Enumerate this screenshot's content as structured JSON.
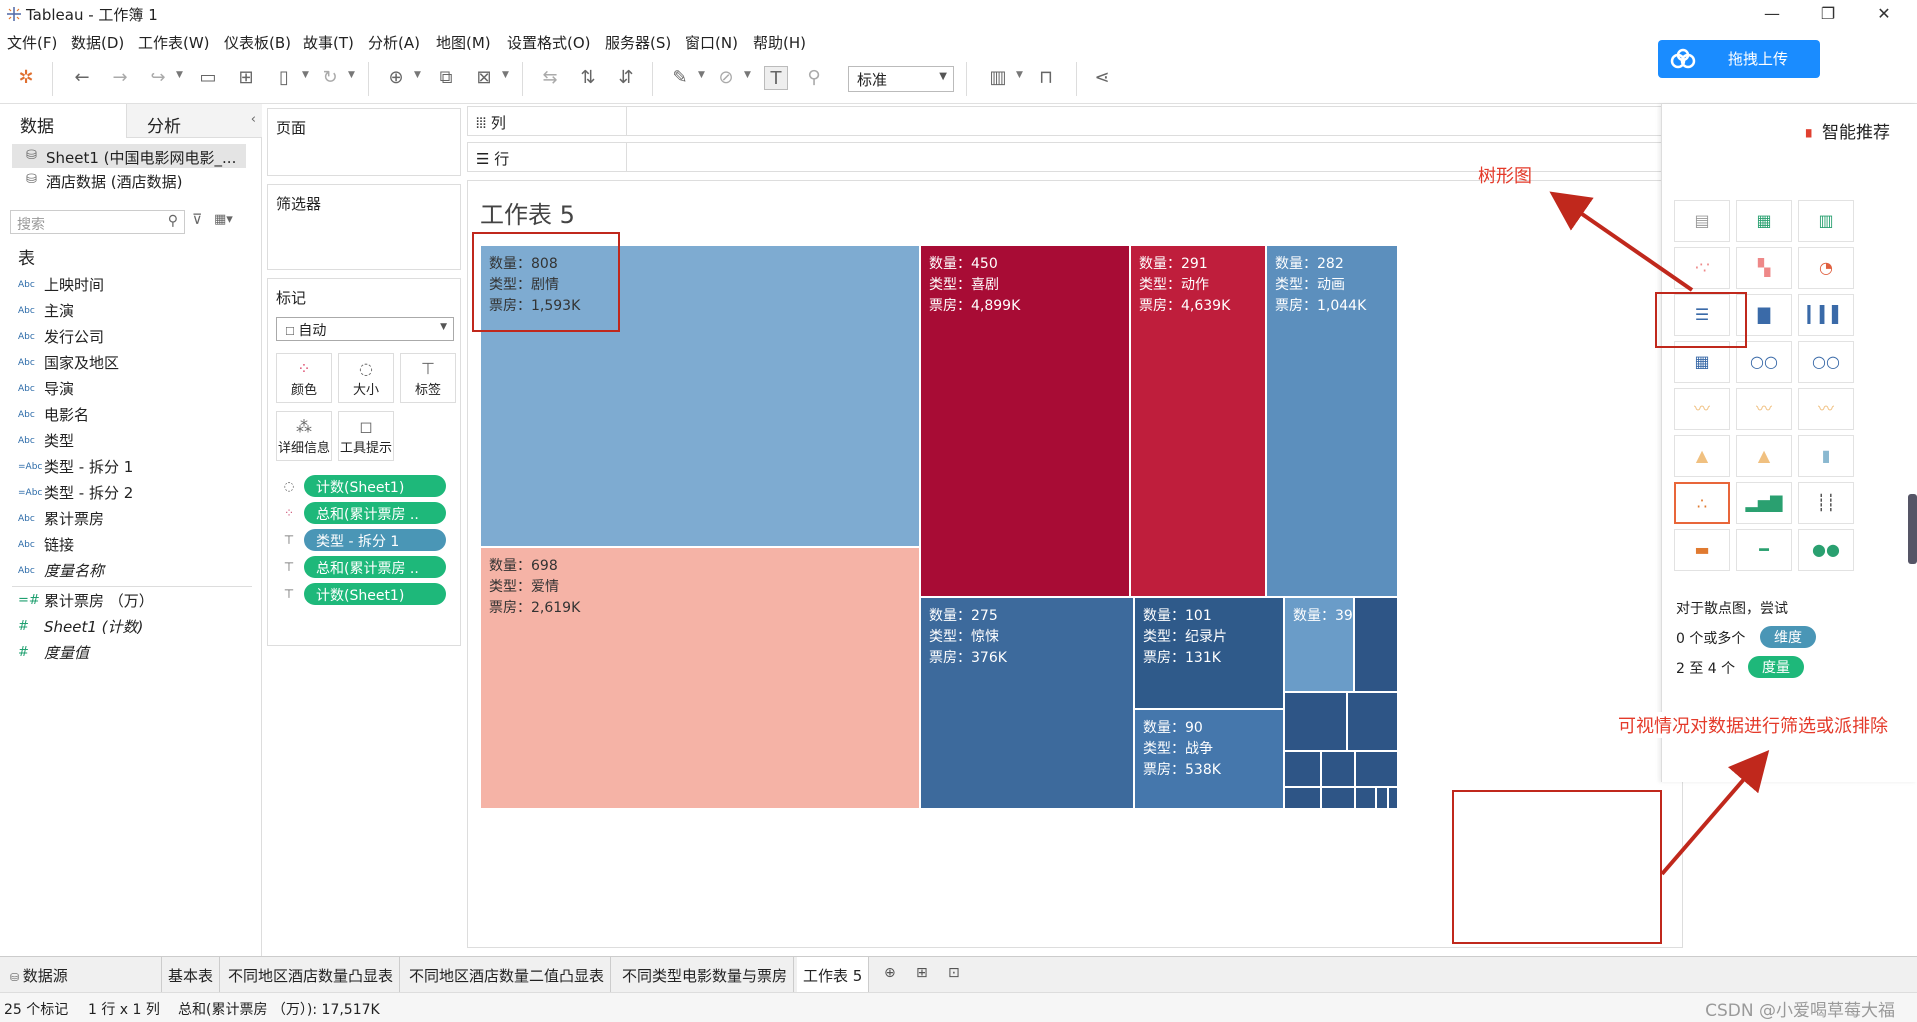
{
  "window": {
    "title": "Tableau - 工作簿 1"
  },
  "menu": [
    "文件(F)",
    "数据(D)",
    "工作表(W)",
    "仪表板(B)",
    "故事(T)",
    "分析(A)",
    "地图(M)",
    "设置格式(O)",
    "服务器(S)",
    "窗口(N)",
    "帮助(H)"
  ],
  "toolbar": {
    "fit_value": "标准"
  },
  "upload_button": "拖拽上传",
  "data_pane": {
    "tab_data": "数据",
    "tab_analysis": "分析",
    "datasources": [
      "Sheet1 (中国电影网电影_...",
      "酒店数据 (酒店数据)"
    ],
    "search_placeholder": "搜索",
    "table_header": "表",
    "dimensions": [
      {
        "type": "Abc",
        "name": "上映时间"
      },
      {
        "type": "Abc",
        "name": "主演"
      },
      {
        "type": "Abc",
        "name": "发行公司"
      },
      {
        "type": "Abc",
        "name": "国家及地区"
      },
      {
        "type": "Abc",
        "name": "导演"
      },
      {
        "type": "Abc",
        "name": "电影名"
      },
      {
        "type": "Abc",
        "name": "类型"
      },
      {
        "type": "=Abc",
        "name": "类型 - 拆分 1"
      },
      {
        "type": "=Abc",
        "name": "类型 - 拆分 2"
      },
      {
        "type": "Abc",
        "name": "累计票房"
      },
      {
        "type": "Abc",
        "name": "链接"
      },
      {
        "type": "Abc",
        "name": "度量名称"
      }
    ],
    "measures": [
      {
        "type": "=#",
        "name": "累计票房 （万）"
      },
      {
        "type": "#",
        "name": "Sheet1 (计数)"
      },
      {
        "type": "#",
        "name": "度量值"
      }
    ]
  },
  "cards": {
    "pages": "页面",
    "filters": "筛选器",
    "marks": "标记",
    "marks_type": "自动",
    "mark_buttons": [
      "颜色",
      "大小",
      "标签",
      "详细信息",
      "工具提示"
    ],
    "pills": [
      {
        "icon": "size",
        "label": "计数(Sheet1)",
        "color": "green"
      },
      {
        "icon": "color",
        "label": "总和(累计票房 ..",
        "color": "green"
      },
      {
        "icon": "label",
        "label": "类型 - 拆分 1",
        "color": "blue"
      },
      {
        "icon": "label",
        "label": "总和(累计票房 ..",
        "color": "green"
      },
      {
        "icon": "label",
        "label": "计数(Sheet1)",
        "color": "green"
      }
    ]
  },
  "shelves": {
    "columns": "列",
    "rows": "行"
  },
  "sheet": {
    "title": "工作表 5"
  },
  "chart_data": {
    "type": "treemap",
    "size_measure": "数量",
    "color_measure": "票房",
    "label_fields": [
      "数量",
      "类型",
      "票房"
    ],
    "items": [
      {
        "count": 808,
        "genre": "剧情",
        "box_office": "1,593K",
        "color": "#7eabd1"
      },
      {
        "count": 698,
        "genre": "爱情",
        "box_office": "2,619K",
        "color": "#f5b3a6"
      },
      {
        "count": 450,
        "genre": "喜剧",
        "box_office": "4,899K",
        "color": "#a80c35"
      },
      {
        "count": 291,
        "genre": "动作",
        "box_office": "4,639K",
        "color": "#bf1e3c"
      },
      {
        "count": 282,
        "genre": "动画",
        "box_office": "1,044K",
        "color": "#5c8fbd"
      },
      {
        "count": 275,
        "genre": "惊悚",
        "box_office": "376K",
        "color": "#3d6a9c"
      },
      {
        "count": 101,
        "genre": "纪录片",
        "box_office": "131K",
        "color": "#2f5a8a"
      },
      {
        "count": 90,
        "genre": "战争",
        "box_office": "538K",
        "color": "#4577ac"
      },
      {
        "count": 39,
        "genre": "",
        "box_office": "",
        "color": "#6a9cc8"
      }
    ],
    "small_cells_color": "#2e5586"
  },
  "showme": {
    "title": "智能推荐",
    "hint": "对于散点图，尝试",
    "req1_prefix": "0 个或多个",
    "req1_badge": "维度",
    "req2_prefix": "2 至 4 个",
    "req2_badge": "度量"
  },
  "annotations": {
    "treemap_label": "树形图",
    "filter_note": "可视情况对数据进行筛选或派排除"
  },
  "tabs": [
    "数据源",
    "基本表",
    "不同地区酒店数量凸显表",
    "不同地区酒店数量二值凸显表",
    "不同类型电影数量与票房",
    "工作表 5"
  ],
  "status": {
    "marks": "25 个标记",
    "dims": "1 行 x 1 列",
    "sum": "总和(累计票房 （万）): 17,517K"
  },
  "watermark": "CSDN @小爱喝草莓大福"
}
